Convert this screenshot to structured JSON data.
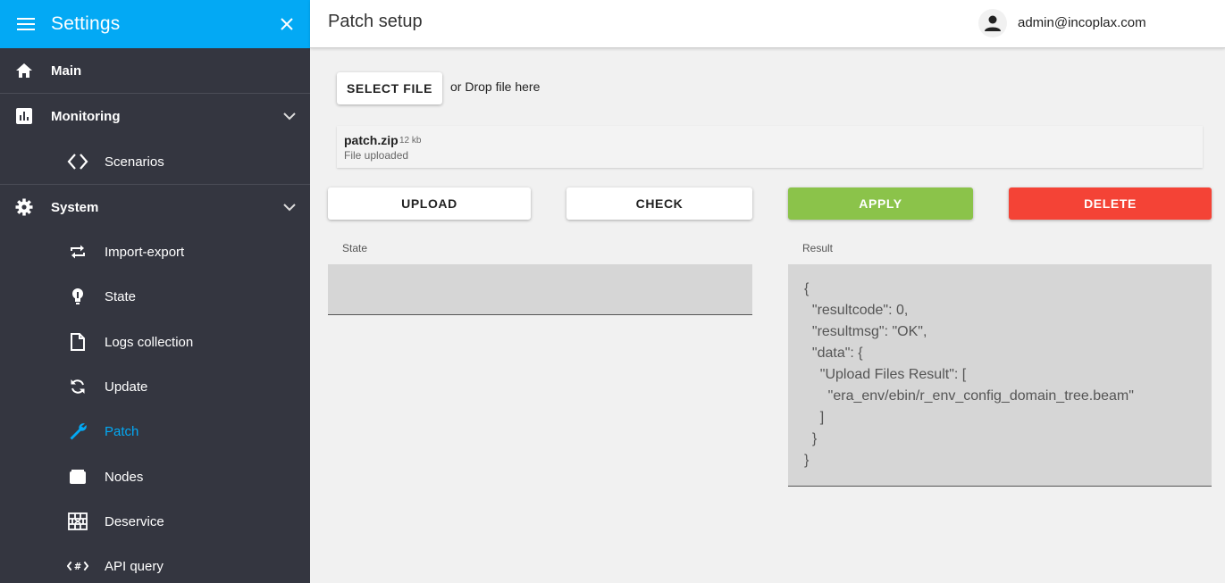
{
  "sidebar": {
    "title": "Settings",
    "items": [
      {
        "label": "Main",
        "icon": "home-icon"
      },
      {
        "label": "Monitoring",
        "icon": "chart-icon"
      },
      {
        "label": "Scenarios",
        "icon": "code-icon"
      },
      {
        "label": "System",
        "icon": "gear-icon"
      },
      {
        "label": "Import-export",
        "icon": "repeat-icon"
      },
      {
        "label": "State",
        "icon": "lightbulb-icon"
      },
      {
        "label": "Logs collection",
        "icon": "file-icon"
      },
      {
        "label": "Update",
        "icon": "sync-icon"
      },
      {
        "label": "Patch",
        "icon": "wrench-icon"
      },
      {
        "label": "Nodes",
        "icon": "nodes-icon"
      },
      {
        "label": "Deservice",
        "icon": "wall-icon"
      },
      {
        "label": "API query",
        "icon": "api-icon"
      }
    ],
    "active_color": "#03a9f4"
  },
  "header": {
    "title": "Patch setup",
    "user_email": "admin@incoplax.com"
  },
  "upload": {
    "select_label": "SELECT FILE",
    "drop_text": "or Drop file here",
    "file": {
      "name": "patch.zip",
      "size": "12 kb",
      "status": "File uploaded"
    }
  },
  "actions": {
    "upload": "UPLOAD",
    "check": "CHECK",
    "apply": "APPLY",
    "delete": "DELETE"
  },
  "state": {
    "label": "State",
    "value": ""
  },
  "result": {
    "label": "Result",
    "lines": [
      "{",
      "  \"resultcode\": 0,",
      "  \"resultmsg\": \"OK\",",
      "  \"data\": {",
      "    \"Upload Files Result\": [",
      "      \"era_env/ebin/r_env_config_domain_tree.beam\"",
      "    ]",
      "  }",
      "}"
    ]
  },
  "colors": {
    "brand": "#03a9f4",
    "sidebar_bg": "#343640",
    "apply": "#8bc34a",
    "delete": "#f44336"
  }
}
